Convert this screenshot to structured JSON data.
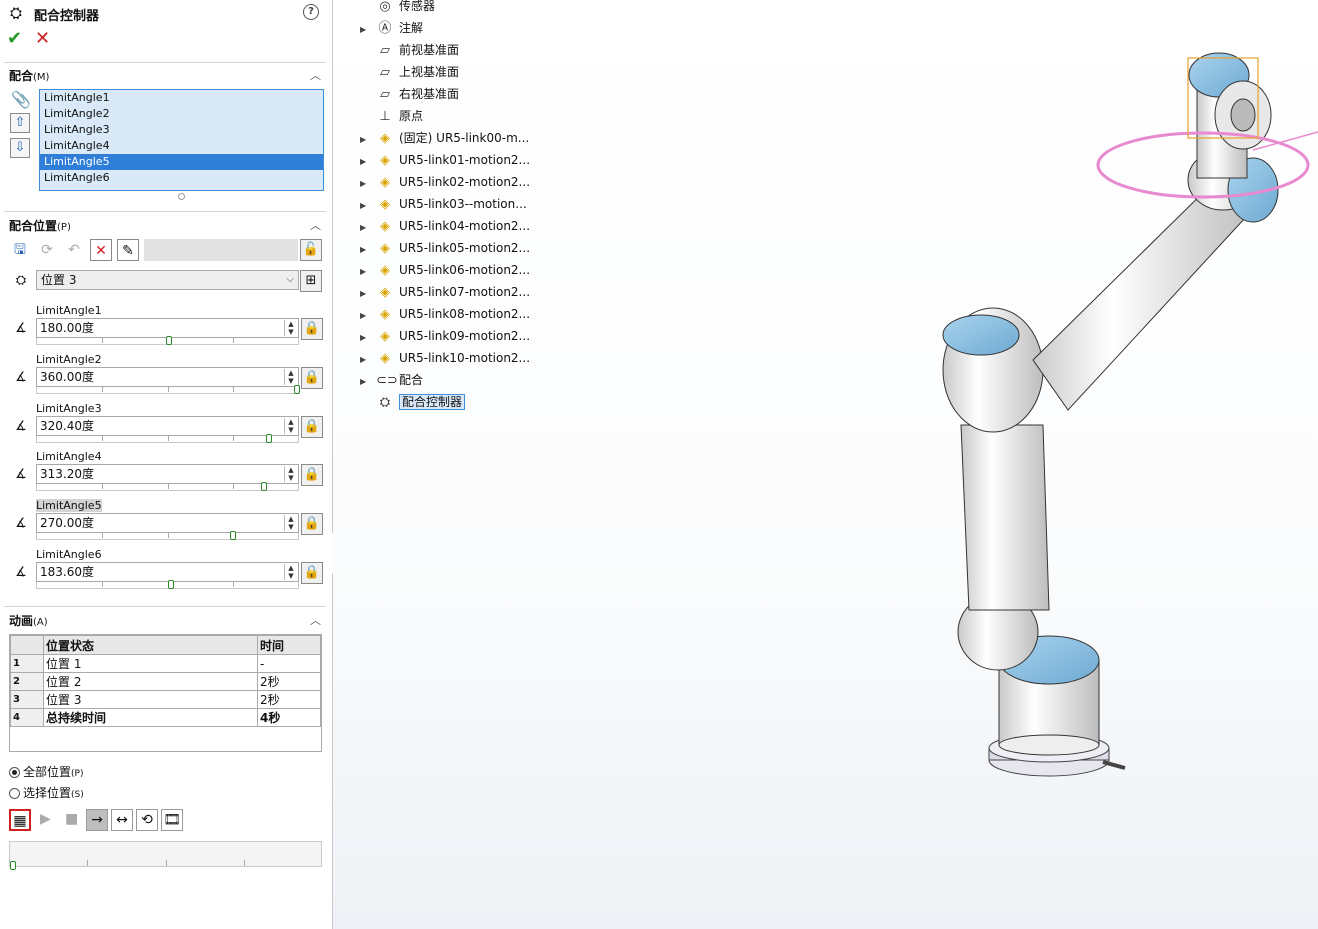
{
  "panel": {
    "title": "配合控制器",
    "help_icon": "question-circle-icon",
    "ok_icon": "checkmark-icon",
    "cancel_icon": "x-icon",
    "mates_section": {
      "title": "配合",
      "hotkey": "(M)",
      "items": [
        "LimitAngle1",
        "LimitAngle2",
        "LimitAngle3",
        "LimitAngle4",
        "LimitAngle5",
        "LimitAngle6"
      ],
      "selected": "LimitAngle5"
    },
    "position_section": {
      "title": "配合位置",
      "hotkey": "(P)",
      "position_value": "位置 3",
      "angles": [
        {
          "label": "LimitAngle1",
          "value": "180.00度",
          "slider": 0.5
        },
        {
          "label": "LimitAngle2",
          "value": "360.00度",
          "slider": 1.0
        },
        {
          "label": "LimitAngle3",
          "value": "320.40度",
          "slider": 0.89
        },
        {
          "label": "LimitAngle4",
          "value": "313.20度",
          "slider": 0.87
        },
        {
          "label": "LimitAngle5",
          "value": "270.00度",
          "slider": 0.75
        },
        {
          "label": "LimitAngle6",
          "value": "183.60度",
          "slider": 0.51
        }
      ]
    },
    "animation_section": {
      "title": "动画",
      "hotkey": "(A)",
      "columns": [
        "位置状态",
        "时间"
      ],
      "rows": [
        {
          "n": "1",
          "state": "位置 1",
          "time": "-"
        },
        {
          "n": "2",
          "state": "位置 2",
          "time": "2秒"
        },
        {
          "n": "3",
          "state": "位置 3",
          "time": "2秒"
        },
        {
          "n": "4",
          "state": "总持续时间",
          "time": "4秒"
        }
      ],
      "radio_all": {
        "label": "全部位置",
        "hotkey": "(P)"
      },
      "radio_select": {
        "label": "选择位置",
        "hotkey": "(S)"
      }
    }
  },
  "tree": {
    "items": [
      {
        "label": "传感器",
        "icon": "sensor-icon",
        "expander": false
      },
      {
        "label": "注解",
        "icon": "annotation-icon",
        "expander": true
      },
      {
        "label": "前视基准面",
        "icon": "plane-icon",
        "expander": false
      },
      {
        "label": "上视基准面",
        "icon": "plane-icon",
        "expander": false
      },
      {
        "label": "右视基准面",
        "icon": "plane-icon",
        "expander": false
      },
      {
        "label": "原点",
        "icon": "origin-icon",
        "expander": false
      },
      {
        "label": "(固定) UR5-link00-m...",
        "icon": "part-icon",
        "expander": true
      },
      {
        "label": "UR5-link01-motion2...",
        "icon": "part-icon",
        "expander": true
      },
      {
        "label": "UR5-link02-motion2...",
        "icon": "part-icon",
        "expander": true
      },
      {
        "label": "UR5-link03--motion...",
        "icon": "part-icon",
        "expander": true
      },
      {
        "label": "UR5-link04-motion2...",
        "icon": "part-icon",
        "expander": true
      },
      {
        "label": "UR5-link05-motion2...",
        "icon": "part-icon",
        "expander": true
      },
      {
        "label": "UR5-link06-motion2...",
        "icon": "part-icon",
        "expander": true
      },
      {
        "label": "UR5-link07-motion2...",
        "icon": "part-icon",
        "expander": true
      },
      {
        "label": "UR5-link08-motion2...",
        "icon": "part-icon",
        "expander": true
      },
      {
        "label": "UR5-link09-motion2...",
        "icon": "part-icon",
        "expander": true
      },
      {
        "label": "UR5-link10-motion2...",
        "icon": "part-icon",
        "expander": true
      },
      {
        "label": "配合",
        "icon": "mates-icon",
        "expander": true
      },
      {
        "label": "配合控制器",
        "icon": "mate-controller-icon",
        "expander": false,
        "selected": true
      }
    ]
  },
  "colors": {
    "accent": "#2f7fd8",
    "list_bg": "#d9e9f7",
    "ok_green": "#2a9a2a",
    "cancel_red": "#d02020",
    "robot_cap": "#8fc3e6",
    "rotation_ring": "#e88ad0"
  }
}
